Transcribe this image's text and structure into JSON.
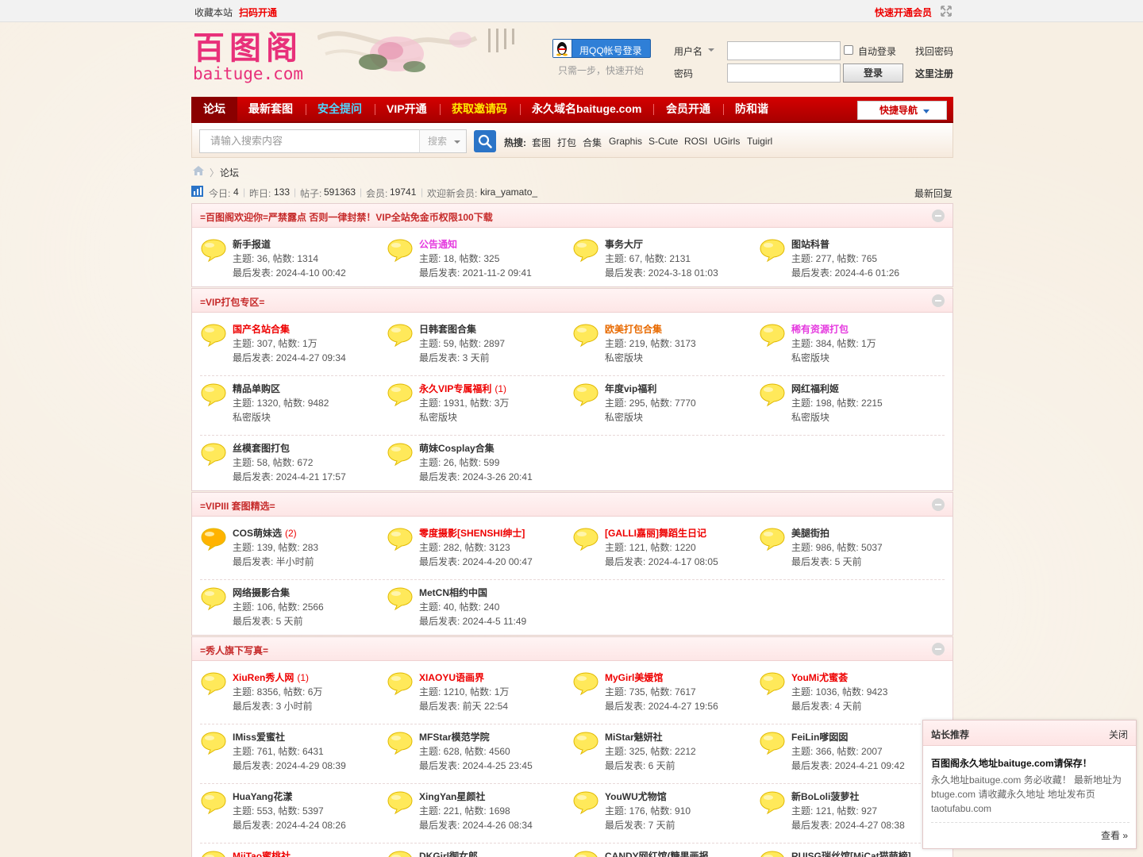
{
  "topbar": {
    "bookmark": "收藏本站",
    "scan": "扫码开通",
    "vip_quick": "快速开通会员"
  },
  "header": {
    "logo_cn": "百图阁",
    "logo_en": "baituge.com",
    "qq_login": "用QQ帐号登录",
    "qq_hint": "只需一步，快速开始",
    "username_label": "用户名",
    "password_label": "密码",
    "auto_login": "自动登录",
    "login_btn": "登录",
    "forgot": "找回密码",
    "register": "这里注册"
  },
  "nav": {
    "items": [
      "论坛",
      "最新套图",
      "安全提问",
      "VIP开通",
      "获取邀请码",
      "永久域名baituge.com",
      "会员开通",
      "防和谐"
    ],
    "quick_nav": "快捷导航"
  },
  "search": {
    "placeholder": "请输入搜索内容",
    "type": "搜索",
    "hot_label": "热搜:",
    "hot": [
      "套图",
      "打包",
      "合集",
      "Graphis",
      "S-Cute",
      "ROSI",
      "UGirls",
      "Tuigirl"
    ]
  },
  "breadcrumb": {
    "current": "论坛"
  },
  "stats": {
    "today_label": "今日:",
    "today": "4",
    "yesterday_label": "昨日:",
    "yesterday": "133",
    "posts_label": "帖子:",
    "posts": "591363",
    "members_label": "会员:",
    "members": "19741",
    "welcome_label": "欢迎新会员:",
    "newest_member": "kira_yamato_",
    "latest_reply": "最新回复"
  },
  "sections": [
    {
      "title": "=百图阁欢迎你=严禁露点 否则一律封禁！VIP全站免金币权限100下载",
      "forums": [
        {
          "name": "新手报道",
          "style": "",
          "count": "",
          "stats": "主题: 36, 帖数: 1314",
          "last": "最后发表: 2024-4-10 00:42"
        },
        {
          "name": "公告通知",
          "style": "pink",
          "count": "",
          "stats": "主题: 18, 帖数: 325",
          "last": "最后发表: 2021-11-2 09:41"
        },
        {
          "name": "事务大厅",
          "style": "",
          "count": "",
          "stats": "主题: 67, 帖数: 2131",
          "last": "最后发表: 2024-3-18 01:03"
        },
        {
          "name": "图站科普",
          "style": "",
          "count": "",
          "stats": "主题: 277, 帖数: 765",
          "last": "最后发表: 2024-4-6 01:26"
        }
      ]
    },
    {
      "title": "=VIP打包专区=",
      "forums": [
        {
          "name": "国产名站合集",
          "style": "red",
          "count": "",
          "stats": "主题: 307, 帖数: 1万",
          "last": "最后发表: 2024-4-27 09:34"
        },
        {
          "name": "日韩套图合集",
          "style": "",
          "count": "",
          "stats": "主题: 59, 帖数: 2897",
          "last": "最后发表: 3 天前"
        },
        {
          "name": "欧美打包合集",
          "style": "orange",
          "count": "",
          "stats": "主题: 219, 帖数: 3173",
          "last": "私密版块"
        },
        {
          "name": "稀有资源打包",
          "style": "pink",
          "count": "",
          "stats": "主题: 384, 帖数: 1万",
          "last": "私密版块"
        },
        {
          "name": "精品单购区",
          "style": "",
          "count": "",
          "stats": "主题: 1320, 帖数: 9482",
          "last": "私密版块"
        },
        {
          "name": "永久VIP专属福利",
          "style": "red",
          "count": "(1)",
          "stats": "主题: 1931, 帖数: 3万",
          "last": "私密版块"
        },
        {
          "name": "年度vip福利",
          "style": "",
          "count": "",
          "stats": "主题: 295, 帖数: 7770",
          "last": "私密版块"
        },
        {
          "name": "网红福利姬",
          "style": "",
          "count": "",
          "stats": "主题: 198, 帖数: 2215",
          "last": "私密版块"
        },
        {
          "name": "丝模套图打包",
          "style": "",
          "count": "",
          "stats": "主题: 58, 帖数: 672",
          "last": "最后发表: 2024-4-21 17:57"
        },
        {
          "name": "萌妹Cosplay合集",
          "style": "",
          "count": "",
          "stats": "主题: 26, 帖数: 599",
          "last": "最后发表: 2024-3-26 20:41"
        }
      ]
    },
    {
      "title": "=VIPIII 套图精选=",
      "forums": [
        {
          "name": "COS萌妹选",
          "style": "",
          "count": "(2)",
          "stats": "主题: 139, 帖数: 283",
          "last": "最后发表: 半小时前",
          "hot": true
        },
        {
          "name": "零度摄影[SHENSHI绅士]",
          "style": "red",
          "count": "",
          "stats": "主题: 282, 帖数: 3123",
          "last": "最后发表: 2024-4-20 00:47"
        },
        {
          "name": "[GALLI嘉丽]舞蹈生日记",
          "style": "red",
          "count": "",
          "stats": "主题: 121, 帖数: 1220",
          "last": "最后发表: 2024-4-17 08:05"
        },
        {
          "name": "美腿街拍",
          "style": "",
          "count": "",
          "stats": "主题: 986, 帖数: 5037",
          "last": "最后发表: 5 天前"
        },
        {
          "name": "网络摄影合集",
          "style": "",
          "count": "",
          "stats": "主题: 106, 帖数: 2566",
          "last": "最后发表: 5 天前"
        },
        {
          "name": "MetCN相约中国",
          "style": "",
          "count": "",
          "stats": "主题: 40, 帖数: 240",
          "last": "最后发表: 2024-4-5 11:49"
        }
      ]
    },
    {
      "title": "=秀人旗下写真=",
      "forums": [
        {
          "name": "XiuRen秀人网",
          "style": "red",
          "count": "(1)",
          "stats": "主题: 8356, 帖数: 6万",
          "last": "最后发表: 3 小时前"
        },
        {
          "name": "XIAOYU语画界",
          "style": "red",
          "count": "",
          "stats": "主题: 1210, 帖数: 1万",
          "last": "最后发表: 前天 22:54"
        },
        {
          "name": "MyGirl美媛馆",
          "style": "red",
          "count": "",
          "stats": "主题: 735, 帖数: 7617",
          "last": "最后发表: 2024-4-27 19:56"
        },
        {
          "name": "YouMi尤蜜荟",
          "style": "red",
          "count": "",
          "stats": "主题: 1036, 帖数: 9423",
          "last": "最后发表: 4 天前"
        },
        {
          "name": "IMiss爱蜜社",
          "style": "",
          "count": "",
          "stats": "主题: 761, 帖数: 6431",
          "last": "最后发表: 2024-4-29 08:39"
        },
        {
          "name": "MFStar模范学院",
          "style": "",
          "count": "",
          "stats": "主题: 628, 帖数: 4560",
          "last": "最后发表: 2024-4-25 23:45"
        },
        {
          "name": "MiStar魅妍社",
          "style": "",
          "count": "",
          "stats": "主题: 325, 帖数: 2212",
          "last": "最后发表: 6 天前"
        },
        {
          "name": "FeiLin嗲囡囡",
          "style": "",
          "count": "",
          "stats": "主题: 366, 帖数: 2007",
          "last": "最后发表: 2024-4-21 09:42"
        },
        {
          "name": "HuaYang花漾",
          "style": "",
          "count": "",
          "stats": "主题: 553, 帖数: 5397",
          "last": "最后发表: 2024-4-24 08:26"
        },
        {
          "name": "XingYan星颜社",
          "style": "",
          "count": "",
          "stats": "主题: 221, 帖数: 1698",
          "last": "最后发表: 2024-4-26 08:34"
        },
        {
          "name": "YouWU尤物馆",
          "style": "",
          "count": "",
          "stats": "主题: 176, 帖数: 910",
          "last": "最后发表: 7 天前"
        },
        {
          "name": "新BoLoli菠萝社",
          "style": "",
          "count": "",
          "stats": "主题: 121, 帖数: 927",
          "last": "最后发表: 2024-4-27 08:38"
        },
        {
          "name": "MiiTao蜜桃社",
          "style": "red",
          "count": "",
          "stats": "",
          "last": ""
        },
        {
          "name": "DKGirl御女郎",
          "style": "",
          "count": "",
          "stats": "",
          "last": ""
        },
        {
          "name": "CANDY网红馆(糖果画报",
          "style": "",
          "count": "",
          "stats": "",
          "last": ""
        },
        {
          "name": "RUISG瑞丝馆[MiCat猫萌榜]",
          "style": "",
          "count": "",
          "stats": "",
          "last": ""
        }
      ]
    }
  ],
  "popup": {
    "title": "站长推荐",
    "close": "关闭",
    "headline": "百图阁永久地址baituge.com请保存！",
    "body": "永久地址baituge.com 务必收藏！ 最新地址为btuge.com 请收藏永久地址 地址发布页taotufabu.com",
    "more": "查看 »"
  },
  "colors": {
    "nav_red": "#c40000",
    "accent_red": "#e00000",
    "link_pink": "#e53adf",
    "logo_pink": "#e8307a",
    "search_blue": "#2b74c7",
    "bubble_yellow": "#ffe95a"
  }
}
